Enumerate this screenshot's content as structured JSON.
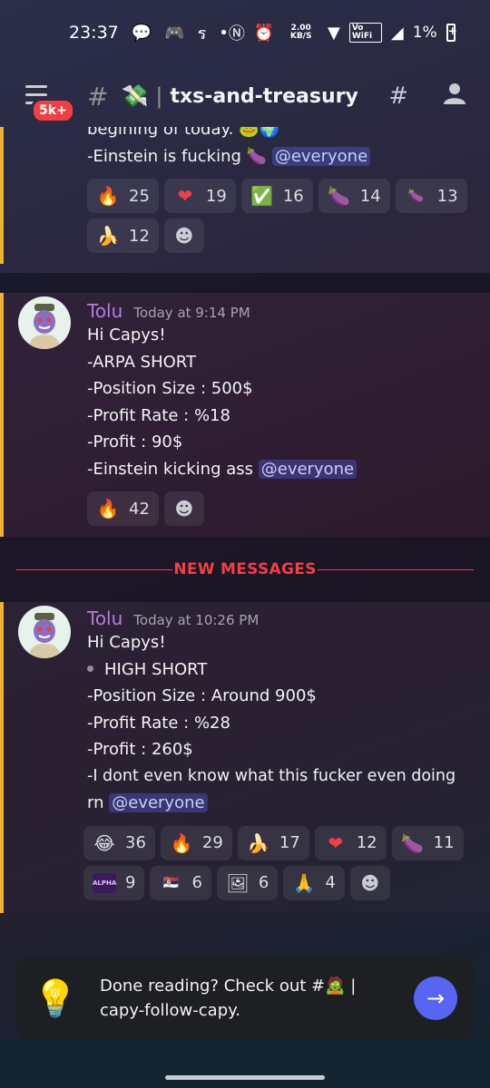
{
  "status_bar": {
    "time": "23:37",
    "net_speed": "2.00 KB/S",
    "wifi_label": "Vo WiFi",
    "battery": "1%"
  },
  "header": {
    "unread_badge": "5k+",
    "channel_icon": "money-with-wings-icon",
    "channel_name": "txs-and-treasury"
  },
  "messages": [
    {
      "partial": true,
      "lines": [
        "begining of today.",
        "-Einstein is fucking"
      ],
      "mention": "@everyone",
      "reactions": [
        {
          "emoji": "🔥",
          "count": "25"
        },
        {
          "emoji": "❤",
          "count": "19"
        },
        {
          "emoji": "✅",
          "count": "16"
        },
        {
          "emoji": "🍆",
          "count": "14"
        },
        {
          "emoji": "🍆",
          "count": "13"
        },
        {
          "emoji": "🍌",
          "count": "12"
        }
      ]
    },
    {
      "author": "Tolu",
      "timestamp": "Today at 9:14 PM",
      "lines": [
        "Hi Capys!",
        "-ARPA SHORT",
        "-Position Size : 500$",
        "-Profit Rate : %18",
        "-Profit : 90$",
        "-Einstein kicking ass"
      ],
      "mention": "@everyone",
      "reactions": [
        {
          "emoji": "🔥",
          "count": "42"
        }
      ]
    },
    {
      "author": "Tolu",
      "timestamp": "Today at 10:26 PM",
      "lines": [
        "Hi Capys!",
        "HIGH SHORT",
        "-Position Size : Around 900$",
        "-Profit Rate : %28",
        "-Profit : 260$",
        "-I dont even know what this fucker even doing",
        "rn"
      ],
      "mention": "@everyone",
      "reactions": [
        {
          "emoji": "😂",
          "count": "36"
        },
        {
          "emoji": "🔥",
          "count": "29"
        },
        {
          "emoji": "🍌",
          "count": "17"
        },
        {
          "emoji": "❤",
          "count": "12"
        },
        {
          "emoji": "🍆",
          "count": "11"
        },
        {
          "emoji": "ALPHA",
          "count": "9"
        },
        {
          "emoji": "🇷🇸",
          "count": "6"
        },
        {
          "emoji": "🖼",
          "count": "6"
        },
        {
          "emoji": "🙏",
          "count": "4"
        }
      ]
    }
  ],
  "new_messages_label": "NEW MESSAGES",
  "done_card": {
    "text_line1": "Done reading? Check out #🧟 |",
    "text_line2": "capy-follow-capy."
  },
  "colors": {
    "accent": "#5865f2",
    "author": "#b57edc",
    "unread_bar": "#f0b232",
    "new_messages": "#f23f43"
  }
}
